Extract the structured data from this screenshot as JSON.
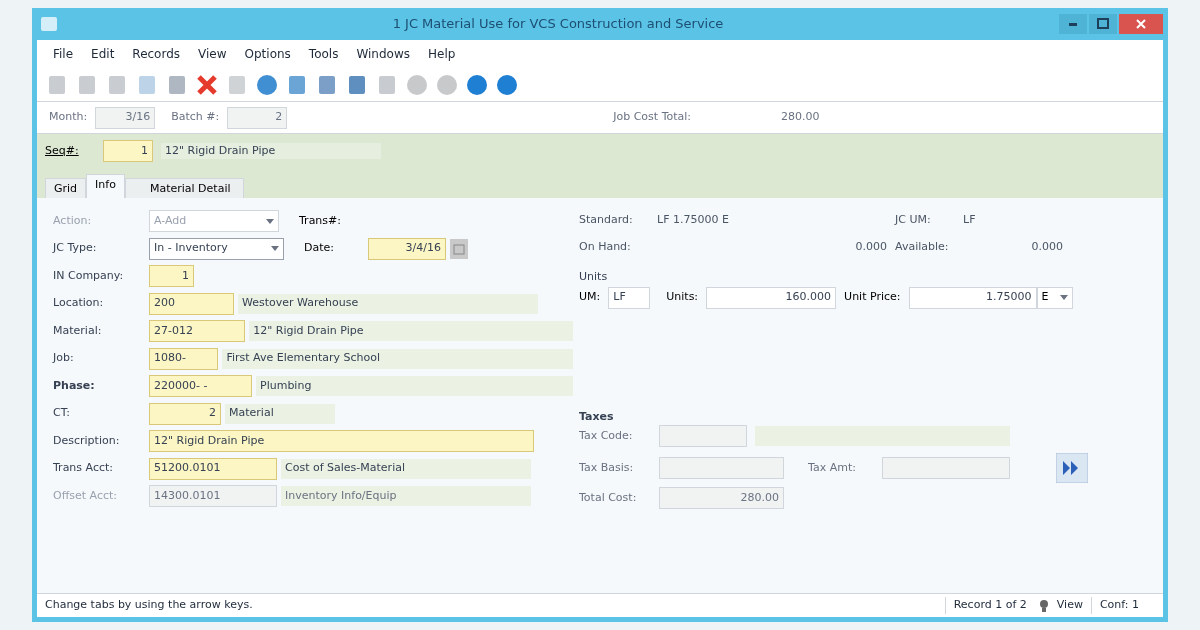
{
  "window": {
    "title": "1 JC Material Use for VCS Construction and Service"
  },
  "menu": [
    "File",
    "Edit",
    "Records",
    "View",
    "Options",
    "Tools",
    "Windows",
    "Help"
  ],
  "header": {
    "fields": [
      {
        "label": "Month:",
        "value": "3/16"
      },
      {
        "label": "Batch #:",
        "value": "2"
      }
    ],
    "total": {
      "label": "Job Cost Total:",
      "value": "280.00"
    }
  },
  "seq": {
    "label": "Seq#:",
    "value": "1",
    "description": "12\" Rigid Drain Pipe"
  },
  "tabs": [
    {
      "label": "Grid",
      "selected": false
    },
    {
      "label": "Info",
      "selected": true
    },
    {
      "label": "Material Detail",
      "selected": false
    }
  ],
  "left_rows": [
    {
      "label": "Action:",
      "kind": "combo",
      "value": "A-Add",
      "required": false,
      "disabled": true,
      "bold": false
    },
    {
      "label": "JC Type:",
      "kind": "combo",
      "value": "In - Inventory",
      "required": false,
      "disabled": false,
      "bold": false
    },
    {
      "label": "IN Company:",
      "kind": "field",
      "value": "1",
      "required": true,
      "disabled": false,
      "bold": false
    },
    {
      "label": "Location:",
      "kind": "field",
      "value": "200",
      "description": "Westover Warehouse",
      "required": true,
      "disabled": false,
      "bold": false
    },
    {
      "label": "Material:",
      "kind": "field",
      "value": "27-012",
      "description": "12\" Rigid Drain Pipe",
      "required": true,
      "disabled": false,
      "bold": false
    },
    {
      "label": "Job:",
      "kind": "field",
      "value": "1080-",
      "description": "First Ave Elementary School",
      "required": true,
      "disabled": false,
      "bold": false
    },
    {
      "label": "Phase:",
      "kind": "field",
      "value": "220000- -",
      "description": "Plumbing",
      "required": true,
      "disabled": false,
      "bold": true
    },
    {
      "label": "CT:",
      "kind": "field",
      "value": "2",
      "description": "Material",
      "required": true,
      "disabled": false,
      "bold": false
    },
    {
      "label": "Description:",
      "kind": "long",
      "value": "12\" Rigid Drain Pipe",
      "required": true,
      "disabled": false,
      "bold": false
    },
    {
      "label": "Trans Acct:",
      "kind": "field",
      "value": "51200.0101",
      "description": "Cost of Sales-Material",
      "required": true,
      "disabled": false,
      "bold": false
    },
    {
      "label": "Offset Acct:",
      "kind": "field",
      "value": "14300.0101",
      "description": "Inventory Info/Equip",
      "required": false,
      "disabled": true,
      "bold": false
    }
  ],
  "trans": {
    "label": "Trans#:"
  },
  "date": {
    "label": "Date:",
    "value": "3/4/16"
  },
  "stock": {
    "standard_label": "Standard:",
    "standard": "LF 1.75000 E",
    "jc_um_label": "JC UM:",
    "jc_um": "LF",
    "on_hand_label": "On Hand:",
    "on_hand": "0.000",
    "available_label": "Available:",
    "available": "0.000"
  },
  "units": {
    "title": "Units",
    "um_label": "UM:",
    "um": "LF",
    "units_label": "Units:",
    "units": "160.000",
    "price_label": "Unit Price:",
    "price": "1.75000",
    "ecm": "E"
  },
  "taxes": {
    "title": "Taxes",
    "code_label": "Tax Code:",
    "basis_label": "Tax Basis:",
    "amt_label": "Tax Amt:",
    "total_label": "Total Cost:",
    "total": "280.00"
  },
  "status": {
    "message": "Change tabs by using the arrow keys.",
    "record": "Record 1 of 2",
    "mode": "View",
    "conf": "Conf: 1"
  }
}
